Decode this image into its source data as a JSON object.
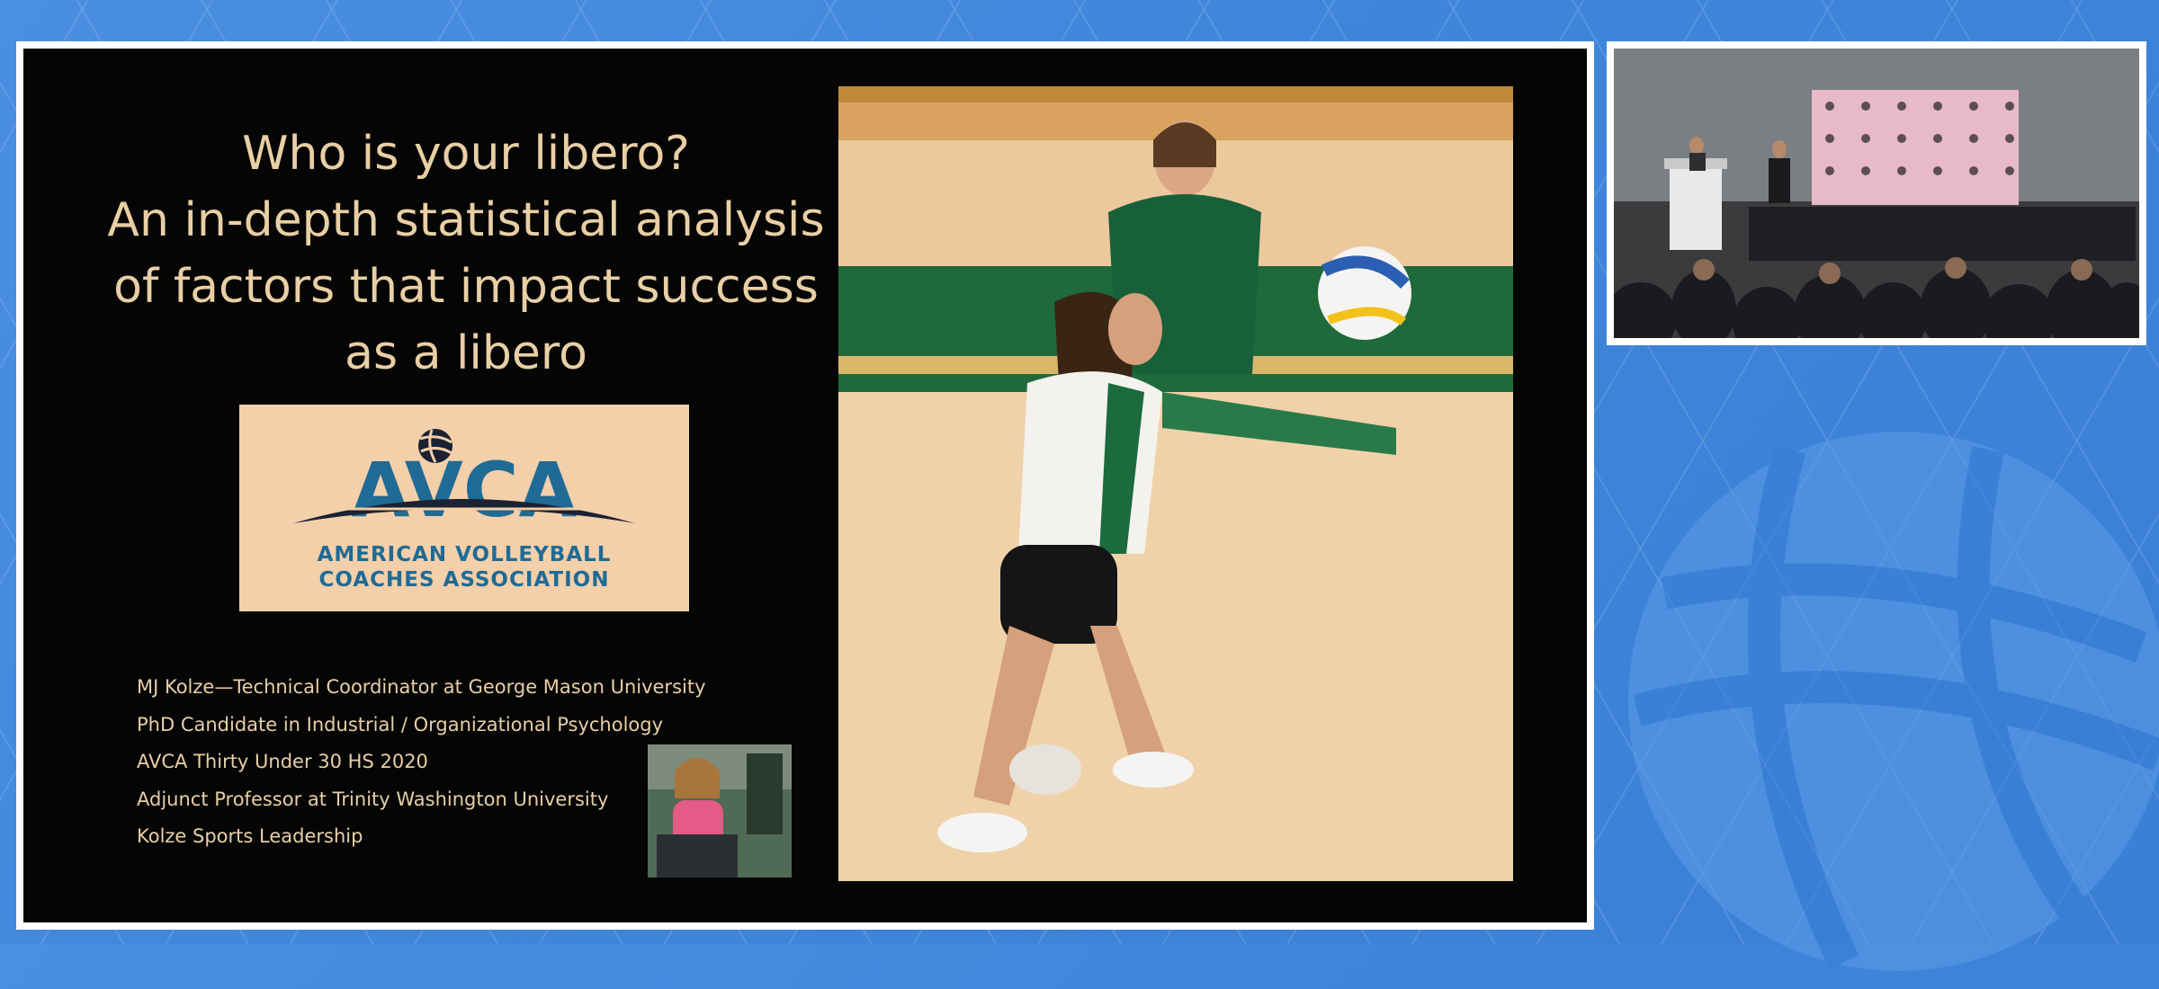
{
  "slide": {
    "title_lines": [
      "Who is your libero?",
      "An in-depth statistical analysis",
      "of factors that impact success",
      "as a libero"
    ],
    "logo": {
      "wordmark": "AVCA",
      "line1": "AMERICAN VOLLEYBALL",
      "line2": "COACHES ASSOCIATION"
    },
    "bio_lines": [
      "MJ Kolze—Technical Coordinator at George Mason University",
      "PhD Candidate in Industrial / Organizational Psychology",
      "AVCA Thirty Under 30 HS 2020",
      "Adjunct Professor at Trinity Washington University",
      "Kolze Sports Leadership"
    ]
  },
  "colors": {
    "background_blue": "#3f86db",
    "slide_background": "#050505",
    "title_text": "#e9cfa4",
    "logo_background": "#f3cfaa",
    "logo_blue": "#1f6b95"
  },
  "icons": {
    "volleyball": "volleyball-icon"
  }
}
